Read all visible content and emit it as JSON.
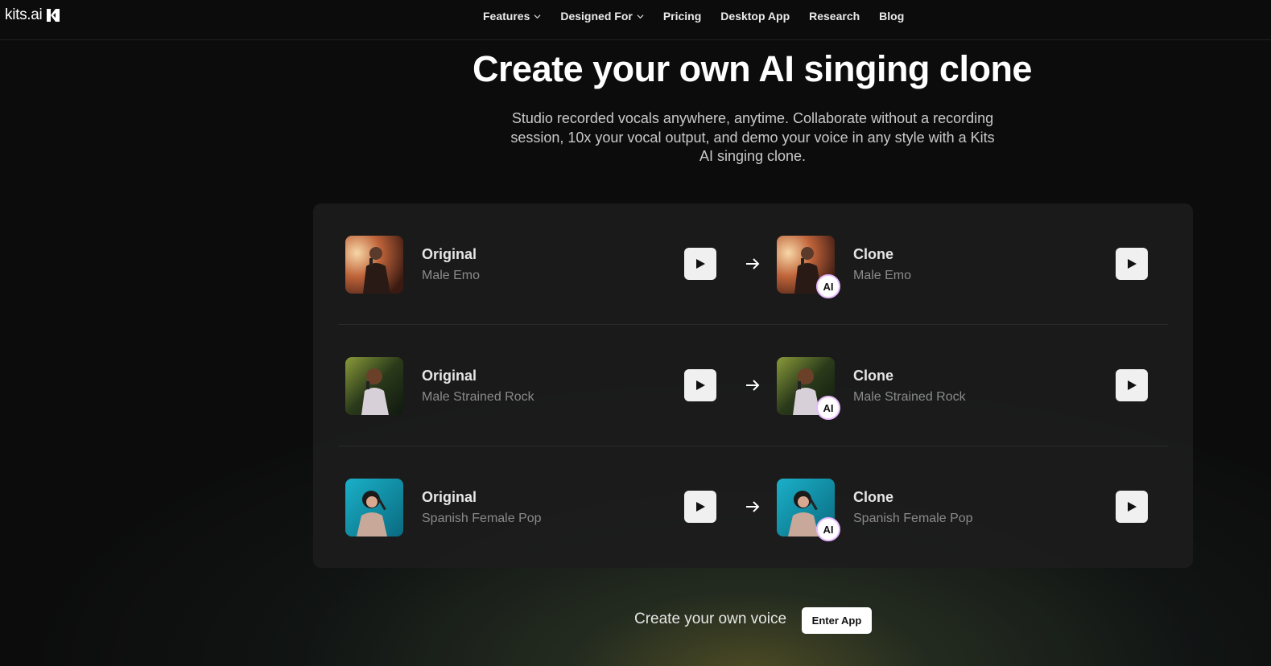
{
  "nav": {
    "logo_text": "kits.ai",
    "links": [
      {
        "label": "Features",
        "dropdown": true
      },
      {
        "label": "Designed For",
        "dropdown": true
      },
      {
        "label": "Pricing",
        "dropdown": false
      },
      {
        "label": "Desktop App",
        "dropdown": false
      },
      {
        "label": "Research",
        "dropdown": false
      },
      {
        "label": "Blog",
        "dropdown": false
      }
    ]
  },
  "hero": {
    "title": "Create your own AI singing clone",
    "subtitle": "Studio recorded vocals anywhere, anytime. Collaborate without a recording session, 10x your vocal output, and demo your voice in any style with a Kits AI singing clone."
  },
  "comparisons": [
    {
      "original_label": "Original",
      "original_style": "Male Emo",
      "clone_label": "Clone",
      "clone_style": "Male Emo",
      "badge": "AI"
    },
    {
      "original_label": "Original",
      "original_style": "Male Strained Rock",
      "clone_label": "Clone",
      "clone_style": "Male Strained Rock",
      "badge": "AI"
    },
    {
      "original_label": "Original",
      "original_style": "Spanish Female Pop",
      "clone_label": "Clone",
      "clone_style": "Spanish Female Pop",
      "badge": "AI"
    }
  ],
  "cta": {
    "text": "Create your own voice",
    "button_label": "Enter App"
  },
  "icons": {
    "play": "play-icon",
    "arrow": "arrow-right-icon",
    "chevron": "chevron-down-icon"
  },
  "colors": {
    "background": "#0c0c0c",
    "card": "#1c1c1c",
    "badge_border": "#e7b9ff",
    "play_button": "#f0f0f0"
  }
}
